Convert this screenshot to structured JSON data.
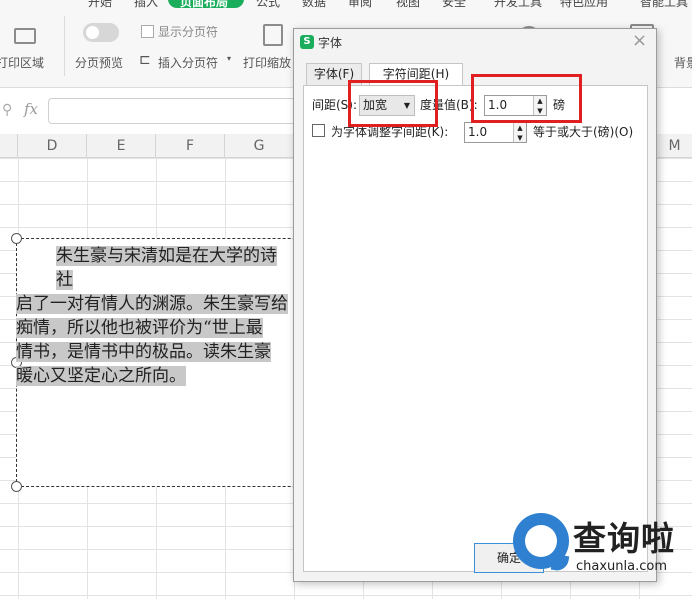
{
  "ribbon": {
    "tabs_cut": [
      "开始",
      "插入",
      "页面布局",
      "公式",
      "数据",
      "审阅",
      "视图",
      "安全",
      "开发工具",
      "特色应用",
      "智能工具"
    ],
    "print_area_label": "打印区域",
    "page_break_preview_label": "分页预览",
    "show_page_break_label": "显示分页符",
    "insert_page_break_label": "插入分页符",
    "print_scale_label": "打印缩放",
    "background_label": "背景"
  },
  "formula_bar": {
    "fx_label": "fx",
    "value": ""
  },
  "sheet": {
    "columns": [
      "D",
      "E",
      "F",
      "G",
      "M"
    ],
    "text_lines": [
      "朱生豪与宋清如是在大学的诗社",
      "启了一对有情人的渊源。朱生豪写给",
      "痴情，所以他也被评价为“世上最",
      "情书，是情书中的极品。读朱生豪",
      "暖心又坚定心之所向。"
    ]
  },
  "dialog": {
    "title": "字体",
    "logo": "S",
    "close_glyph": "×",
    "tabs": [
      {
        "label": "字体(F)"
      },
      {
        "label": "字符间距(H)"
      }
    ],
    "spacing_label": "间距(S):",
    "spacing_value": "加宽",
    "measure_label": "度量值(B):",
    "measure_value": "1.0",
    "measure_unit": "磅",
    "kerning_label": "为字体调整字间距(K):",
    "kerning_value": "1.0",
    "kerning_suffix": "等于或大于(磅)(O)",
    "ok_label": "确定"
  },
  "watermark": {
    "text": "查询啦",
    "url": "chaxunla.com"
  },
  "colors": {
    "accent_green": "#1aad5c",
    "highlight_red": "#e02020",
    "watermark_blue": "#2f80d1"
  }
}
